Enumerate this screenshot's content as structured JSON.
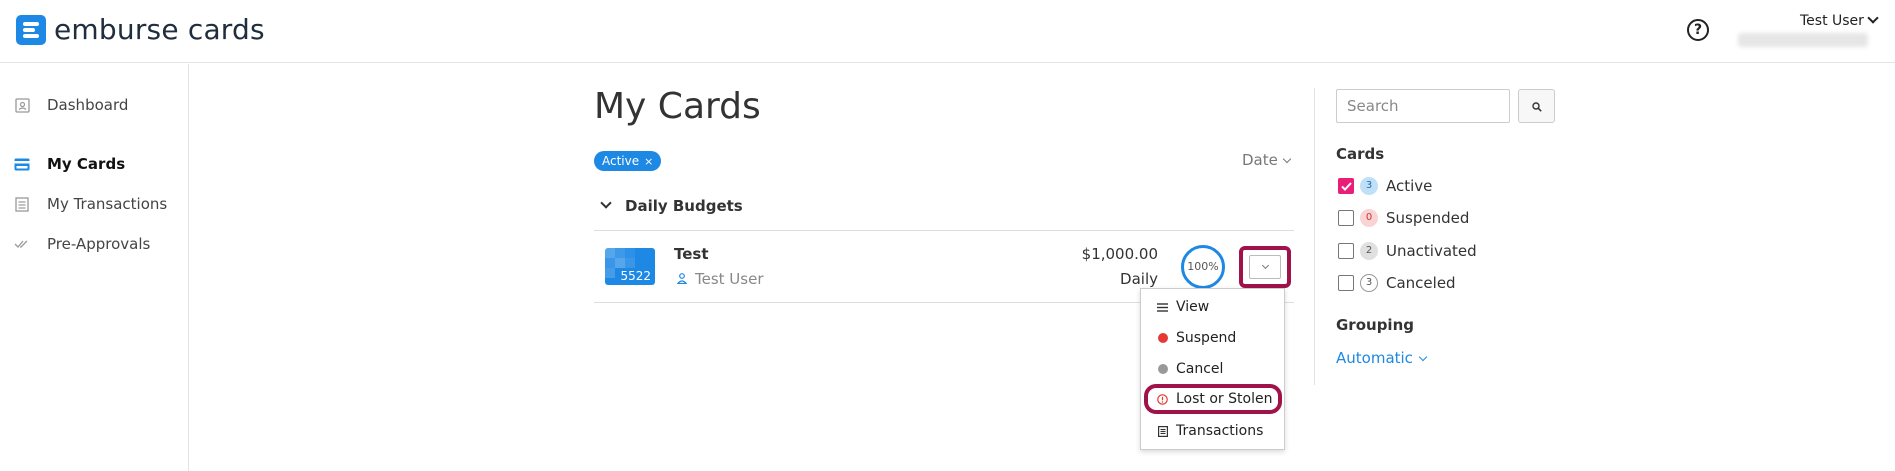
{
  "header": {
    "logo_text": "emburse cards",
    "help_icon": "question-circle-icon",
    "user_name": "Test User"
  },
  "sidebar": {
    "items": [
      {
        "label": "Dashboard",
        "icon": "dashboard-icon",
        "active": false
      },
      {
        "label": "My Cards",
        "icon": "credit-card-icon",
        "active": true
      },
      {
        "label": "My Transactions",
        "icon": "receipt-icon",
        "active": false
      },
      {
        "label": "Pre-Approvals",
        "icon": "double-check-icon",
        "active": false
      }
    ]
  },
  "main": {
    "title": "My Cards",
    "active_filter": {
      "label": "Active",
      "remove": "×"
    },
    "sort": {
      "label": "Date"
    },
    "group": {
      "label": "Daily Budgets"
    },
    "card": {
      "last4": "5522",
      "name": "Test",
      "holder": "Test User",
      "amount": "$1,000.00",
      "period": "Daily",
      "progress": "100%"
    },
    "menu": {
      "items": [
        {
          "label": "View",
          "icon": "list-icon"
        },
        {
          "label": "Suspend",
          "icon": "red-dot-icon"
        },
        {
          "label": "Cancel",
          "icon": "gray-dot-icon"
        },
        {
          "label": "Lost or Stolen",
          "icon": "alert-circle-icon"
        },
        {
          "label": "Transactions",
          "icon": "document-icon"
        }
      ]
    }
  },
  "filters": {
    "search_placeholder": "Search",
    "cards_heading": "Cards",
    "cards": [
      {
        "label": "Active",
        "count": "3",
        "checked": true
      },
      {
        "label": "Suspended",
        "count": "0",
        "checked": false
      },
      {
        "label": "Unactivated",
        "count": "2",
        "checked": false
      },
      {
        "label": "Canceled",
        "count": "3",
        "checked": false
      }
    ],
    "grouping_heading": "Grouping",
    "grouping_value": "Automatic"
  },
  "colors": {
    "accent": "#1e88e5",
    "highlight": "#a0124a",
    "checked": "#e91e78",
    "suspend": "#e53935"
  }
}
